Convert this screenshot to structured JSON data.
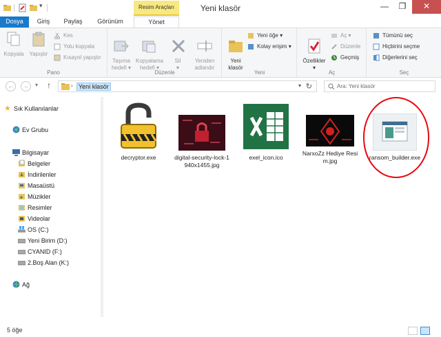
{
  "window": {
    "title": "Yeni klasör",
    "context_tab_header": "Resim Araçları",
    "minimize": "—",
    "maximize": "❐",
    "close": "✕"
  },
  "tabs": {
    "file": "Dosya",
    "home": "Giriş",
    "share": "Paylaş",
    "view": "Görünüm",
    "manage": "Yönet"
  },
  "ribbon": {
    "clipboard": {
      "label": "Pano",
      "copy": "Kopyala",
      "paste": "Yapıştır",
      "cut": "Kes",
      "copy_path": "Yolu kopyala",
      "paste_shortcut": "Kısayol yapıştır"
    },
    "organize": {
      "label": "Düzenle",
      "move_to": "Taşıma\nhedefi ▾",
      "copy_to": "Kopyalama\nhedefi ▾",
      "delete": "Sil\n▾",
      "rename": "Yeniden\nadlandır"
    },
    "new": {
      "label": "Yeni",
      "new_folder": "Yeni\nklasör",
      "new_item": "Yeni öğe ▾",
      "easy_access": "Kolay erişim ▾"
    },
    "open": {
      "label": "Aç",
      "properties": "Özellikler\n▾",
      "open": "Aç ▾",
      "edit": "Düzenle",
      "history": "Geçmiş"
    },
    "select": {
      "label": "Seç",
      "select_all": "Tümünü seç",
      "select_none": "Hiçbirini seçme",
      "invert": "Diğerlerini seç"
    }
  },
  "address": {
    "back": "←",
    "forward": "→",
    "up": "↑",
    "crumb": "Yeni klasör",
    "search_placeholder": "Ara: Yeni klasör"
  },
  "nav": {
    "favorites": "Sık Kullanılanlar",
    "homegroup": "Ev Grubu",
    "computer": "Bilgisayar",
    "items": [
      "Belgeler",
      "İndirilenler",
      "Masaüstü",
      "Müzikler",
      "Resimler",
      "Videolar",
      "OS (C:)",
      "Yeni Birim (D:)",
      "CYANID (F:)",
      "2.Boş Alan (K:)"
    ],
    "network": "Ağ"
  },
  "files": [
    {
      "name": "decryptor.exe",
      "icon": "padlock-icon"
    },
    {
      "name": "digital-security-lock-1940x1455.jpg",
      "icon": "image-thumbnail"
    },
    {
      "name": "exel_icon.ico",
      "icon": "excel-icon"
    },
    {
      "name": "NarxoZz Hediye Resim.jpg",
      "icon": "image-thumbnail"
    },
    {
      "name": "ransom_builder.exe",
      "icon": "app-icon"
    }
  ],
  "status": {
    "count": "5 öğe"
  },
  "colors": {
    "accent": "#1979ca",
    "context_tab": "#f8e880",
    "annotation": "#e8080f"
  }
}
